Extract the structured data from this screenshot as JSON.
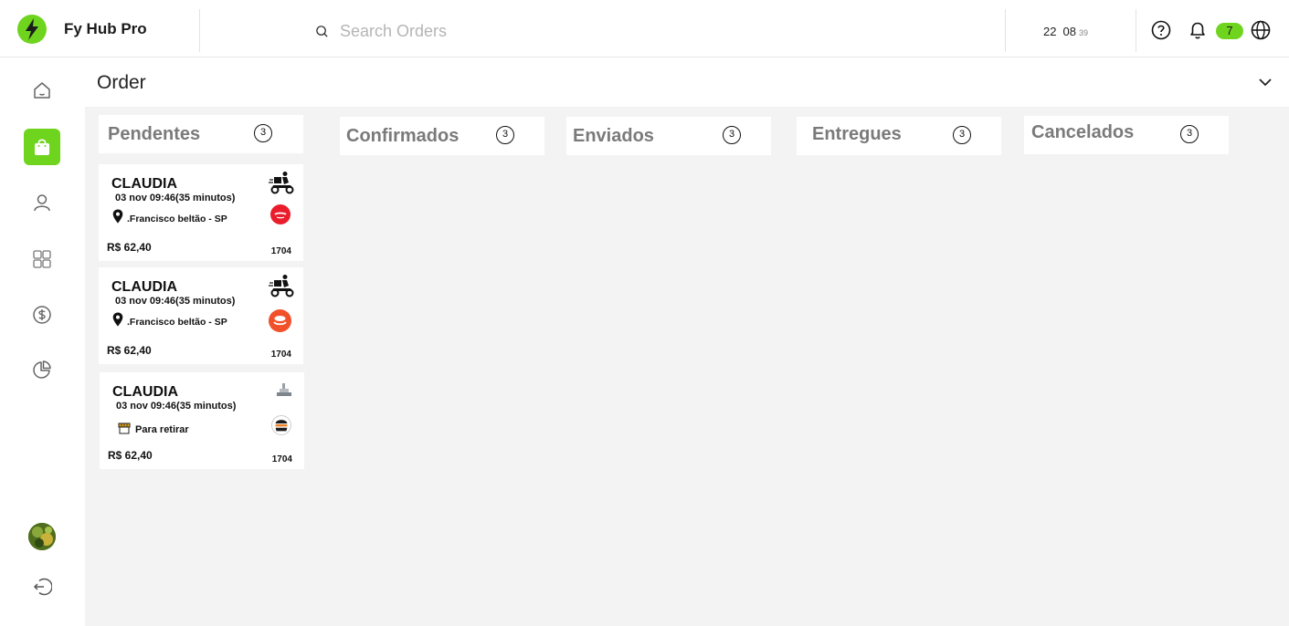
{
  "app": {
    "name": "Fy Hub Pro"
  },
  "search": {
    "placeholder": "Search Orders"
  },
  "clock": {
    "hours": "22",
    "minutes": "08",
    "seconds": "39"
  },
  "notifications": {
    "count": "7"
  },
  "colors": {
    "accent": "#6fd41e",
    "ifood_red": "#ea1d2c",
    "column_title": "#7a7a7a",
    "background": "#f3f3f3"
  },
  "sidebar": {
    "items": [
      {
        "name": "home-icon"
      },
      {
        "name": "shopping-bag-icon",
        "active": true
      },
      {
        "name": "user-icon"
      },
      {
        "name": "grid-icon"
      },
      {
        "name": "dollar-icon"
      },
      {
        "name": "pie-chart-icon"
      }
    ],
    "logout_icon": "logout-icon"
  },
  "page": {
    "title": "Order"
  },
  "columns": [
    {
      "title": "Pendentes",
      "count": "3"
    },
    {
      "title": "Confirmados",
      "count": "3"
    },
    {
      "title": "Enviados",
      "count": "3"
    },
    {
      "title": "Entregues",
      "count": "3"
    },
    {
      "title": "Cancelados",
      "count": "3"
    }
  ],
  "orders": [
    {
      "customer": "CLAUDIA",
      "time": "03 nov 09:46(35 minutos)",
      "location": ".Francisco beltão - SP",
      "price": "R$ 62,40",
      "number": "1704",
      "mode": "delivery",
      "platform": "ifood-logo"
    },
    {
      "customer": "CLAUDIA",
      "time": "03 nov 09:46(35 minutos)",
      "location": ".Francisco beltão - SP",
      "price": "R$ 62,40",
      "number": "1704",
      "mode": "delivery",
      "platform": "orange-platform-logo"
    },
    {
      "customer": "CLAUDIA",
      "time": "03 nov 09:46(35 minutos)",
      "pickup": "Para retirar",
      "price": "R$ 62,40",
      "number": "1704",
      "mode": "pickup",
      "platform": "burger-platform-logo"
    }
  ]
}
